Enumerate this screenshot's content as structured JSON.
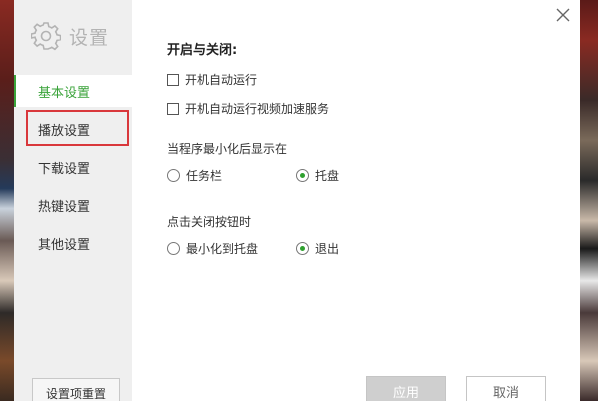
{
  "sidebar": {
    "title": "设置",
    "items": [
      {
        "label": "基本设置",
        "active": true
      },
      {
        "label": "播放设置",
        "active": false
      },
      {
        "label": "下载设置",
        "active": false
      },
      {
        "label": "热键设置",
        "active": false
      },
      {
        "label": "其他设置",
        "active": false
      }
    ],
    "reset_label": "设置项重置"
  },
  "content": {
    "startup_title": "开启与关闭:",
    "auto_start_label": "开机自动运行",
    "auto_accel_label": "开机自动运行视频加速服务",
    "minimize_group_label": "当程序最小化后显示在",
    "minimize_options": [
      "任务栏",
      "托盘"
    ],
    "minimize_selected": "托盘",
    "close_group_label": "点击关闭按钮时",
    "close_options": [
      "最小化到托盘",
      "退出"
    ],
    "close_selected": "退出"
  },
  "buttons": {
    "apply": "应用",
    "cancel": "取消"
  },
  "colors": {
    "accent": "#3aa33a",
    "highlight": "#d9373b"
  }
}
